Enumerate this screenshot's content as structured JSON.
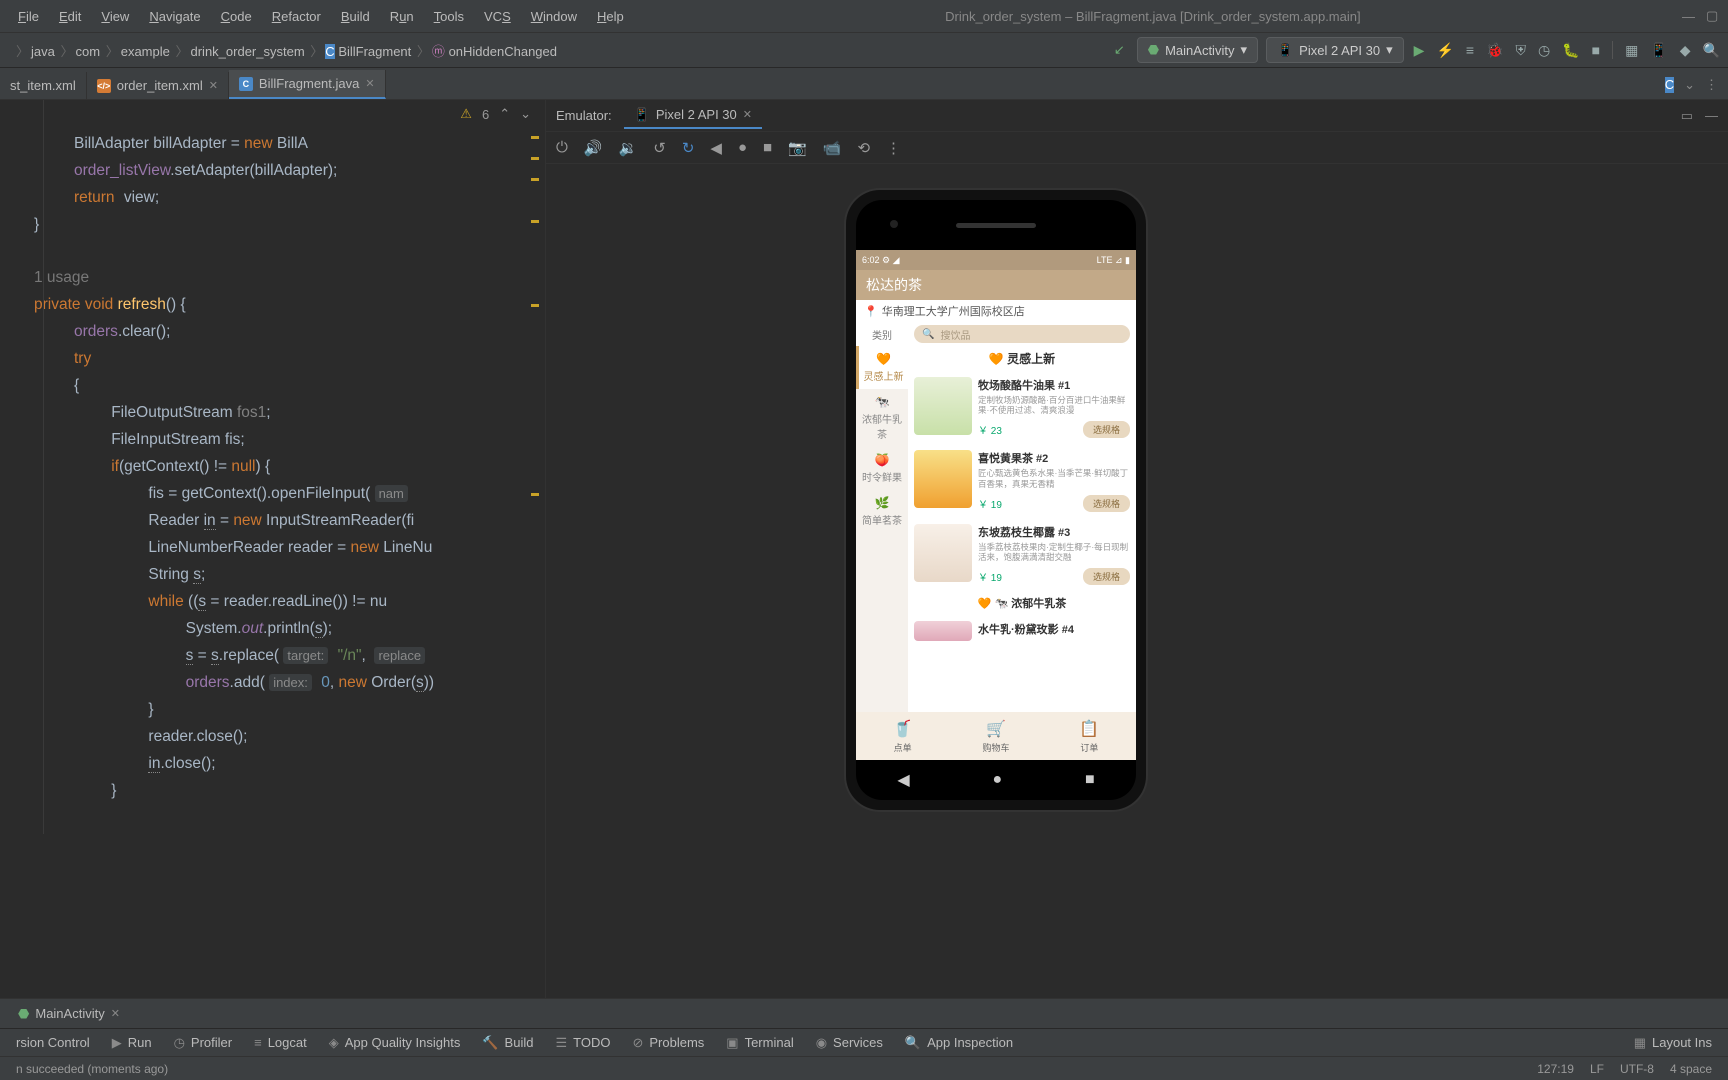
{
  "menu": {
    "file": "File",
    "edit": "Edit",
    "view": "View",
    "navigate": "Navigate",
    "code": "Code",
    "refactor": "Refactor",
    "build": "Build",
    "run": "Run",
    "tools": "Tools",
    "vcs": "VCS",
    "window": "Window",
    "help": "Help"
  },
  "window_title": "Drink_order_system – BillFragment.java [Drink_order_system.app.main]",
  "breadcrumbs": [
    "java",
    "com",
    "example",
    "drink_order_system",
    "BillFragment",
    "onHiddenChanged"
  ],
  "run_config_main": "MainActivity",
  "run_config_device": "Pixel 2 API 30",
  "editor_tabs": [
    {
      "name": "st_item.xml",
      "icon": "xml",
      "active": false,
      "closeable": false
    },
    {
      "name": "order_item.xml",
      "icon": "xml",
      "active": false,
      "closeable": true
    },
    {
      "name": "BillFragment.java",
      "icon": "java",
      "active": true,
      "closeable": true
    }
  ],
  "editor_warning_count": "6",
  "code": {
    "l1a": "BillAdapter billAdapter = ",
    "l1_new": "new",
    "l1b": " BillA",
    "l2a": "order_listView",
    "l2b": ".setAdapter(billAdapter);",
    "l3_ret": "return",
    "l3_view": "view",
    "l3_semi": ";",
    "l4": "}",
    "hint_usage": "1 usage",
    "l6_priv": "private ",
    "l6_void": "void ",
    "l6_refresh": "refresh",
    "l6_rest": "() {",
    "l7_orders": "orders",
    "l7_clear": ".clear();",
    "l8_try": "try",
    "l9_open": "{",
    "l10": "FileOutputStream ",
    "l10v": "fos1",
    "l10s": ";",
    "l11": "FileInputStream fis;",
    "l12_if": "if",
    "l12a": "(getContext() != ",
    "l12_null": "null",
    "l12b": ") {",
    "l13": "fis = getContext().openFileInput( ",
    "l13_hint": "nam",
    "l14a": "Reader ",
    "l14in": "in",
    "l14b": " = ",
    "l14_new": "new",
    "l14c": " InputStreamReader(fi",
    "l15a": "LineNumberReader reader = ",
    "l15_new": "new",
    "l15b": " LineNu",
    "l16": "String ",
    "l16s": "s",
    "l16semi": ";",
    "l17_while": "while",
    "l17a": " ((",
    "l17s": "s",
    "l17b": " = reader.readLine()) != nu",
    "l18a": "System.",
    "l18_out": "out",
    "l18b": ".println(",
    "l18s": "s",
    "l18c": ");",
    "l19s": "s",
    "l19a": " = ",
    "l19s2": "s",
    "l19b": ".replace( ",
    "l19_hint1": "target:",
    "l19_str": "\"/n\"",
    "l19c": ",  ",
    "l19_hint2": "replace",
    "l20_orders": "orders",
    "l20a": ".add( ",
    "l20_hint": "index:",
    "l20_num": "0",
    "l20b": ", ",
    "l20_new": "new",
    "l20c": " Order(",
    "l20s": "s",
    "l20d": "))",
    "l21": "}",
    "l22": "reader.close();",
    "l23a": "in",
    "l23b": ".close();",
    "l24": "}"
  },
  "emulator": {
    "header": "Emulator:",
    "tab": "Pixel 2 API 30",
    "status_time": "6:02",
    "status_right": "LTE ⊿ ▮",
    "app_title": "松达的茶",
    "location": "华南理工大学广州国际校区店",
    "category_header": "类别",
    "search_placeholder": "搜饮品",
    "categories": [
      {
        "icon": "🧡",
        "label": "灵感上新",
        "active": true
      },
      {
        "icon": "🐄",
        "label": "浓郁牛乳茶",
        "active": false
      },
      {
        "icon": "🍑",
        "label": "时令鲜果",
        "active": false
      },
      {
        "icon": "🌿",
        "label": "简单茗茶",
        "active": false
      }
    ],
    "section_title": "灵感上新",
    "products": [
      {
        "name": "牧场酸酪牛油果  #1",
        "desc": "定制牧场奶源酸酪·百分百进口牛油果鲜果·不使用过滤、清爽浪漫",
        "price": "￥ 23",
        "btn": "选规格"
      },
      {
        "name": "喜悦黄果茶  #2",
        "desc": "匠心甄选黄色系水果·当季芒果·鲜切酸丁百香果，真果无香精",
        "price": "￥ 19",
        "btn": "选规格"
      },
      {
        "name": "东坡荔枝生椰露  #3",
        "desc": "当季荔枝荔枝果肉·定制生椰子·每日现制活来，饱腹满満清甜交融",
        "price": "￥ 19",
        "btn": "选规格"
      },
      {
        "name": "水牛乳·粉黛玫影  #4",
        "desc": "",
        "price": "",
        "btn": ""
      }
    ],
    "section2_title": "🐄 浓郁牛乳茶",
    "tabs": [
      {
        "icon": "🥤",
        "label": "点单"
      },
      {
        "icon": "🛒",
        "label": "购物车"
      },
      {
        "icon": "📋",
        "label": "订单"
      }
    ]
  },
  "run_tab": "MainActivity",
  "bottom": {
    "vcs": "rsion Control",
    "run": "Run",
    "profiler": "Profiler",
    "logcat": "Logcat",
    "quality": "App Quality Insights",
    "build": "Build",
    "todo": "TODO",
    "problems": "Problems",
    "terminal": "Terminal",
    "services": "Services",
    "inspection": "App Inspection",
    "layout": "Layout Ins"
  },
  "status": {
    "msg": "n succeeded (moments ago)",
    "pos": "127:19",
    "sep": "LF",
    "enc": "UTF-8",
    "indent": "4 space"
  }
}
